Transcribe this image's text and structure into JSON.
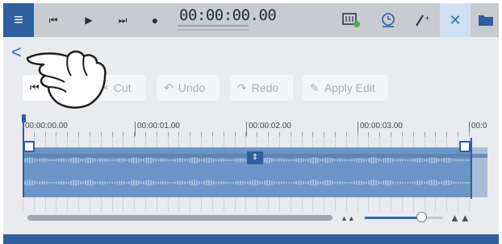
{
  "topbar": {
    "timecode": "00:00:00.00",
    "icons": [
      "menu-icon",
      "skip-back-icon",
      "play-icon",
      "skip-forward-icon",
      "record-icon",
      "mixer-icon",
      "clock-icon",
      "magic-wand-icon",
      "close-icon",
      "folder-icon"
    ]
  },
  "nav": {
    "back_label": "<"
  },
  "toolbar": {
    "cut_label": "Cut",
    "undo_label": "Undo",
    "redo_label": "Redo",
    "apply_edit_label": "Apply Edit"
  },
  "timeline": {
    "ticks": [
      "00:00:00.00",
      "00:00:01.00",
      "00:00:02.00",
      "00:00:03.00",
      "00:0"
    ]
  },
  "colors": {
    "accent": "#2f5f9e",
    "selection": "#6d94c6",
    "close_bg": "#cfe0f2"
  }
}
